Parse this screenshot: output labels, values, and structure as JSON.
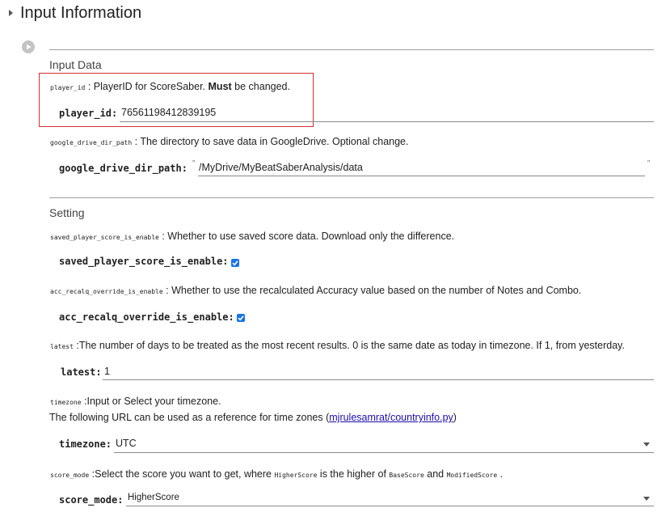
{
  "header": {
    "title": "Input Information"
  },
  "sections": {
    "input_data": {
      "title": "Input Data",
      "player_id": {
        "code": "player_id",
        "desc_pre": " : PlayerID for ScoreSaber. ",
        "desc_bold": "Must",
        "desc_post": " be changed.",
        "label": "player_id:",
        "value": "76561198412839195"
      },
      "google_drive_dir_path": {
        "code": "google_drive_dir_path",
        "desc": " : The directory to save data in GoogleDrive. Optional change.",
        "label": "google_drive_dir_path:",
        "value": "/MyDrive/MyBeatSaberAnalysis/data",
        "quote_open": "\"",
        "quote_close": "\""
      }
    },
    "setting": {
      "title": "Setting",
      "saved_player_score_is_enable": {
        "code": "saved_player_score_is_enable",
        "desc": " : Whether to use saved score data. Download only the difference.",
        "label": "saved_player_score_is_enable:",
        "checked": true
      },
      "acc_recalq_override_is_enable": {
        "code": "acc_recalq_override_is_enable",
        "desc": " : Whether to use the recalculated Accuracy value based on the number of Notes and Combo.",
        "label": "acc_recalq_override_is_enable:",
        "checked": true
      },
      "latest": {
        "code": "latest",
        "desc": " :The number of days to be treated as the most recent results. 0 is the same date as today in timezone. If 1, from yesterday.",
        "label": "latest:",
        "value": "1"
      },
      "timezone": {
        "code": "timezone",
        "desc": " :Input or Select your timezone.",
        "desc2_pre": "The following URL can be used as a reference for time zones (",
        "link_text": "mjrulesamrat/countryinfo.py",
        "desc2_post": ")",
        "label": "timezone:",
        "value": "UTC"
      },
      "score_mode": {
        "code": "score_mode",
        "desc_pre": " :Select the score you want to get, where ",
        "code_a": "HigherScore",
        "desc_mid": " is the higher of ",
        "code_b": "BaseScore",
        "desc_and": " and ",
        "code_c": "ModifiedScore",
        "desc_end": " .",
        "label": "score_mode:",
        "value": "HigherScore"
      }
    }
  },
  "colors": {
    "highlight_box": "#d32f2f",
    "checkbox": "#1a73e8",
    "link": "#1a0dab"
  }
}
